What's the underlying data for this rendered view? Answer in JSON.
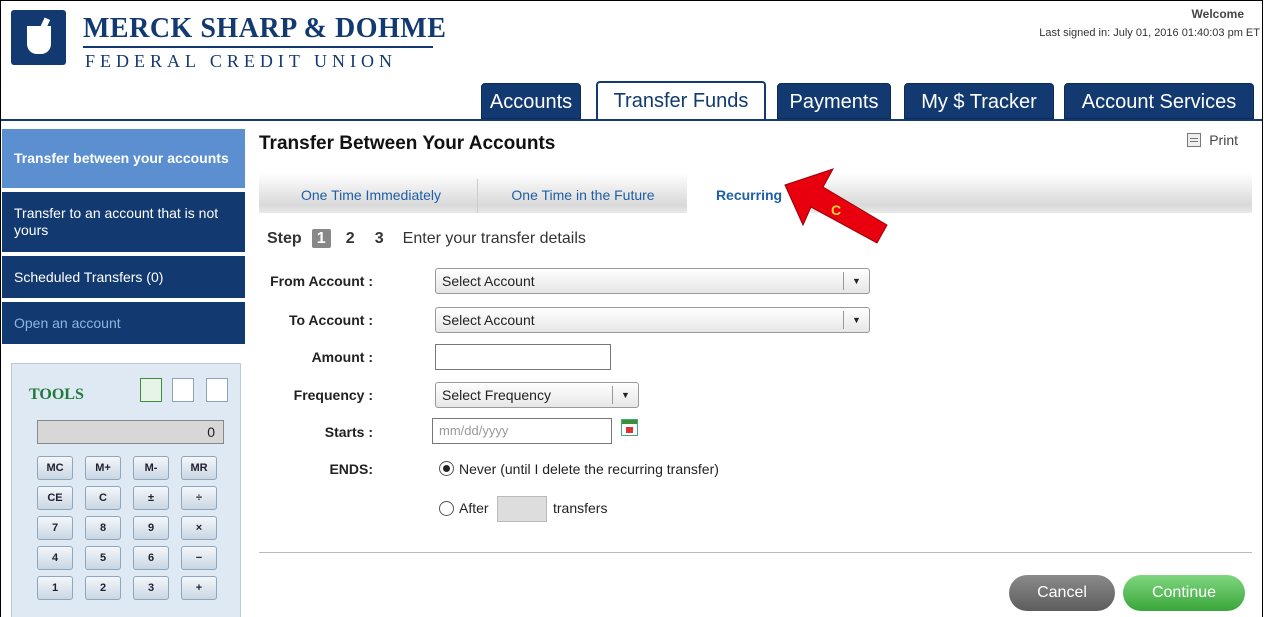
{
  "header": {
    "logo_name": "MERCK SHARP & DOHME",
    "logo_sub": "FEDERAL CREDIT UNION",
    "welcome": "Welcome",
    "last_signed": "Last signed in: July 01, 2016 01:40:03 pm ET"
  },
  "nav": {
    "tabs": [
      {
        "label": "Accounts"
      },
      {
        "label": "Transfer Funds",
        "active": true
      },
      {
        "label": "Payments"
      },
      {
        "label": "My $ Tracker"
      },
      {
        "label": "Account Services"
      }
    ]
  },
  "sidebar": {
    "items": [
      {
        "label": "Transfer between your accounts",
        "active": true
      },
      {
        "label": "Transfer to an account that is not yours"
      },
      {
        "label": "Scheduled Transfers (0)"
      },
      {
        "label": "Open an account"
      }
    ]
  },
  "tools": {
    "label": "TOOLS",
    "icons": [
      "calculator-icon",
      "notes-icon",
      "calendar-icon"
    ],
    "display": "0",
    "keys": [
      [
        "MC",
        "M+",
        "M-",
        "MR"
      ],
      [
        "CE",
        "C",
        "±",
        "÷"
      ],
      [
        "7",
        "8",
        "9",
        "×"
      ],
      [
        "4",
        "5",
        "6",
        "−"
      ],
      [
        "1",
        "2",
        "3",
        "+"
      ]
    ]
  },
  "main": {
    "title": "Transfer Between Your Accounts",
    "print": "Print",
    "subtabs": [
      {
        "label": "One Time Immediately"
      },
      {
        "label": "One Time in the Future"
      },
      {
        "label": "Recurring",
        "active": true
      }
    ],
    "step": {
      "word": "Step",
      "numbers": [
        "1",
        "2",
        "3"
      ],
      "current": "1",
      "description": "Enter your transfer details"
    },
    "form": {
      "from_label": "From Account :",
      "from_value": "Select Account",
      "to_label": "To Account :",
      "to_value": "Select Account",
      "amount_label": "Amount :",
      "amount_value": "",
      "frequency_label": "Frequency :",
      "frequency_value": "Select Frequency",
      "starts_label": "Starts :",
      "starts_placeholder": "mm/dd/yyyy",
      "ends_label": "ENDS:",
      "ends_never": "Never (until I delete the recurring transfer)",
      "ends_after": "After",
      "ends_after_suffix": "transfers",
      "ends_selected": "never"
    },
    "buttons": {
      "cancel": "Cancel",
      "continue": "Continue"
    }
  },
  "annotation": {
    "letter": "C",
    "color": "#e8000f"
  }
}
